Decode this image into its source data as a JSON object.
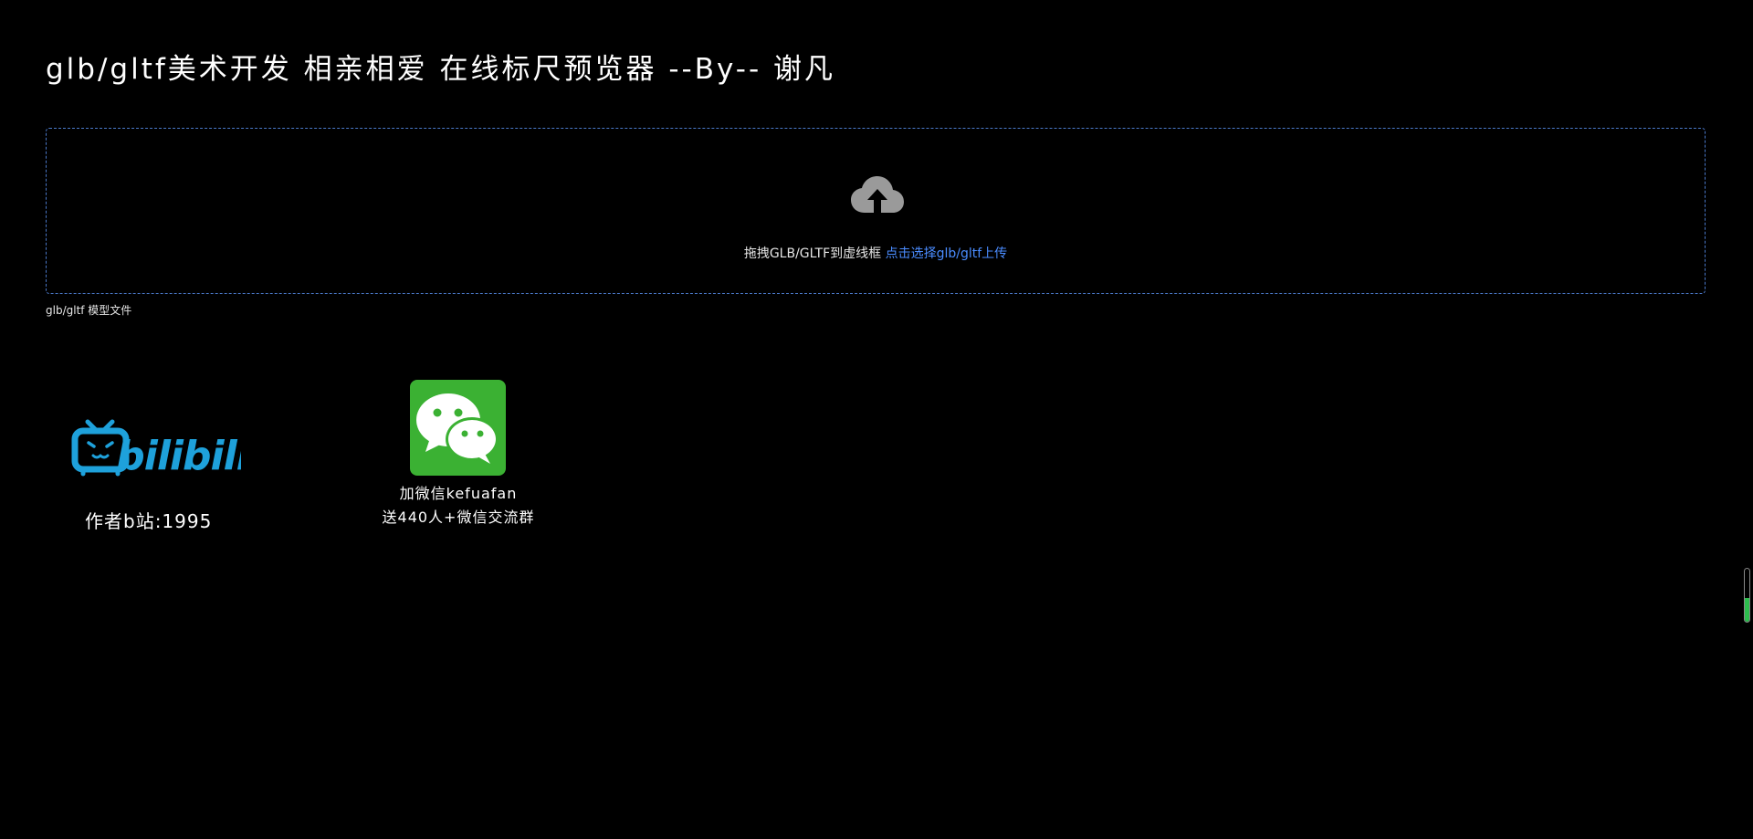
{
  "header": {
    "title": "glb/gltf美术开发 相亲相爱 在线标尺预览器 --By-- 谢凡"
  },
  "upload": {
    "icon": "cloud-upload-icon",
    "drag_text": "拖拽GLB/GLTF到虚线框 ",
    "select_link": "点击选择glb/gltf上传",
    "hint": "glb/gltf 模型文件",
    "border_color": "#4a78c8",
    "link_color": "#4a8cff"
  },
  "social": {
    "bilibili": {
      "logo_text": "bilibili",
      "caption": "作者b站:1995",
      "brand_color": "#1ea1db"
    },
    "wechat": {
      "icon": "wechat-icon",
      "caption_line1": "加微信kefuafan",
      "caption_line2": "送440人+微信交流群",
      "brand_color": "#3bb133"
    }
  },
  "scroll_indicator": {
    "fill_fraction": 0.45,
    "color": "#2dbd4e"
  }
}
